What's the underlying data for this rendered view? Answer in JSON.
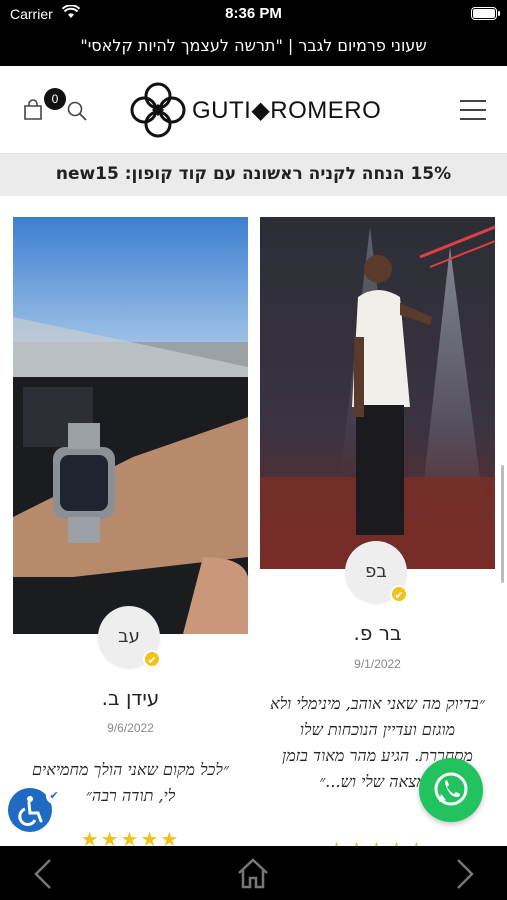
{
  "status_bar": {
    "carrier": "Carrier",
    "time": "8:36 PM"
  },
  "announcement": {
    "text": "שעוני פרמיום לגבר | \"תרשה לעצמך להיות קלאסי\""
  },
  "header": {
    "cart_count": "0",
    "logo_text": "GUTI◆ROMERO",
    "icons": [
      "cart-icon",
      "search-icon",
      "logo-icon",
      "menu-icon"
    ]
  },
  "promo": {
    "text": "15% הנחה לקניה ראשונה עם קוד קופון: new15"
  },
  "reviews": [
    {
      "initials": "בפ",
      "name": "בר פ.",
      "date": "9/1/2022",
      "quote": "״בדיוק מה שאני אוהב, מינימלי ולא מוגזם ועדיין הנוכחות שלו מסחררת. הגיע מהר מאוד בזמן תמצאה שלי וש...״",
      "stars": "★★★★★"
    },
    {
      "initials": "עב",
      "name": "עידן ב.",
      "date": "9/6/2022",
      "quote": "״לכל מקום שאני הולך מחמיאים לי, תודה רבה״",
      "stars": "★★★★★"
    }
  ],
  "colors": {
    "accent": "#f2c21b",
    "whatsapp": "#22c35e",
    "accessibility": "#1f6bc1",
    "bar": "#000000"
  }
}
